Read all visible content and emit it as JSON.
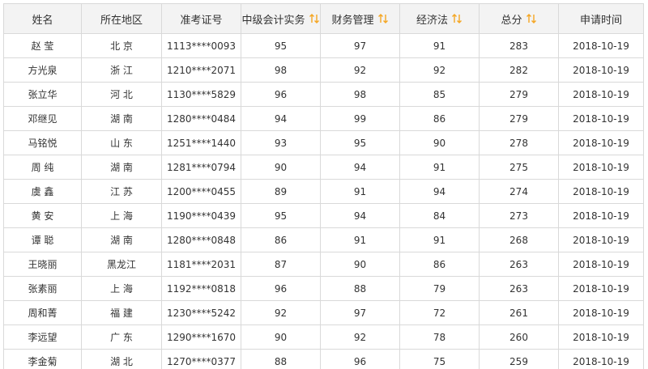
{
  "accent_color": "#f5a623",
  "table": {
    "headers": {
      "name": "姓名",
      "region": "所在地区",
      "ticket": "准考证号",
      "accounting": "中级会计实务",
      "finance": "财务管理",
      "law": "经济法",
      "total": "总分",
      "date": "申请时间"
    },
    "sort_icon": "sort-arrows-icon",
    "rows": [
      {
        "name": "赵 莹",
        "region": "北 京",
        "ticket": "1113****0093",
        "accounting": "95",
        "finance": "97",
        "law": "91",
        "total": "283",
        "date": "2018-10-19"
      },
      {
        "name": "方光泉",
        "region": "浙 江",
        "ticket": "1210****2071",
        "accounting": "98",
        "finance": "92",
        "law": "92",
        "total": "282",
        "date": "2018-10-19"
      },
      {
        "name": "张立华",
        "region": "河 北",
        "ticket": "1130****5829",
        "accounting": "96",
        "finance": "98",
        "law": "85",
        "total": "279",
        "date": "2018-10-19"
      },
      {
        "name": "邓继见",
        "region": "湖 南",
        "ticket": "1280****0484",
        "accounting": "94",
        "finance": "99",
        "law": "86",
        "total": "279",
        "date": "2018-10-19"
      },
      {
        "name": "马铭悦",
        "region": "山 东",
        "ticket": "1251****1440",
        "accounting": "93",
        "finance": "95",
        "law": "90",
        "total": "278",
        "date": "2018-10-19"
      },
      {
        "name": "周 纯",
        "region": "湖 南",
        "ticket": "1281****0794",
        "accounting": "90",
        "finance": "94",
        "law": "91",
        "total": "275",
        "date": "2018-10-19"
      },
      {
        "name": "虞 鑫",
        "region": "江 苏",
        "ticket": "1200****0455",
        "accounting": "89",
        "finance": "91",
        "law": "94",
        "total": "274",
        "date": "2018-10-19"
      },
      {
        "name": "黄 安",
        "region": "上 海",
        "ticket": "1190****0439",
        "accounting": "95",
        "finance": "94",
        "law": "84",
        "total": "273",
        "date": "2018-10-19"
      },
      {
        "name": "谭 聪",
        "region": "湖 南",
        "ticket": "1280****0848",
        "accounting": "86",
        "finance": "91",
        "law": "91",
        "total": "268",
        "date": "2018-10-19"
      },
      {
        "name": "王晓丽",
        "region": "黑龙江",
        "ticket": "1181****2031",
        "accounting": "87",
        "finance": "90",
        "law": "86",
        "total": "263",
        "date": "2018-10-19"
      },
      {
        "name": "张素丽",
        "region": "上 海",
        "ticket": "1192****0818",
        "accounting": "96",
        "finance": "88",
        "law": "79",
        "total": "263",
        "date": "2018-10-19"
      },
      {
        "name": "周和菁",
        "region": "福 建",
        "ticket": "1230****5242",
        "accounting": "92",
        "finance": "97",
        "law": "72",
        "total": "261",
        "date": "2018-10-19"
      },
      {
        "name": "李远望",
        "region": "广 东",
        "ticket": "1290****1670",
        "accounting": "90",
        "finance": "92",
        "law": "78",
        "total": "260",
        "date": "2018-10-19"
      },
      {
        "name": "李金菊",
        "region": "湖 北",
        "ticket": "1270****0377",
        "accounting": "88",
        "finance": "96",
        "law": "75",
        "total": "259",
        "date": "2018-10-19"
      }
    ]
  }
}
